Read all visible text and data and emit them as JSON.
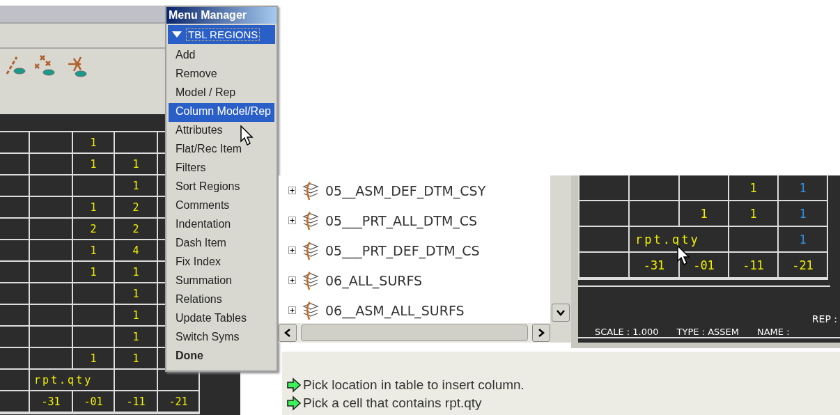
{
  "left_drawing": {
    "rows": [
      [
        null,
        null,
        "1",
        null,
        null
      ],
      [
        null,
        null,
        "1",
        "1",
        null
      ],
      [
        null,
        null,
        null,
        "1",
        null
      ],
      [
        null,
        null,
        "1",
        "2",
        null
      ],
      [
        null,
        null,
        "2",
        "2",
        null
      ],
      [
        null,
        null,
        "1",
        "4",
        null
      ],
      [
        null,
        null,
        "1",
        "1",
        null
      ],
      [
        null,
        null,
        null,
        "1",
        null
      ],
      [
        null,
        null,
        null,
        "1",
        null
      ],
      [
        null,
        null,
        null,
        "1",
        null
      ],
      [
        null,
        null,
        "1",
        "1",
        null
      ],
      [
        null,
        "rpt.qty",
        null,
        null,
        null
      ],
      [
        null,
        "-31",
        "-01",
        "-11",
        "-21"
      ]
    ]
  },
  "menu_manager": {
    "title": "Menu Manager",
    "header": {
      "label": "TBL REGIONS",
      "expanded": true
    },
    "items": [
      {
        "label": "Add",
        "selected": false
      },
      {
        "label": "Remove",
        "selected": false
      },
      {
        "label": "Model / Rep",
        "selected": false
      },
      {
        "label": "Column Model/Rep",
        "selected": true
      },
      {
        "label": "Attributes",
        "selected": false
      },
      {
        "label": "Flat/Rec Item",
        "selected": false
      },
      {
        "label": "Filters",
        "selected": false
      },
      {
        "label": "Sort Regions",
        "selected": false
      },
      {
        "label": "Comments",
        "selected": false
      },
      {
        "label": "Indentation",
        "selected": false
      },
      {
        "label": "Dash Item",
        "selected": false
      },
      {
        "label": "Fix Index",
        "selected": false
      },
      {
        "label": "Summation",
        "selected": false
      },
      {
        "label": "Relations",
        "selected": false
      },
      {
        "label": "Update Tables",
        "selected": false
      },
      {
        "label": "Switch Syms",
        "selected": false
      }
    ],
    "done": "Done"
  },
  "layer_tree": {
    "items": [
      {
        "label": "05__ASM_DEF_DTM_CSY",
        "expanded": false
      },
      {
        "label": "05___PRT_ALL_DTM_CS",
        "expanded": false
      },
      {
        "label": "05___PRT_DEF_DTM_CS",
        "expanded": false
      },
      {
        "label": "06_ALL_SURFS",
        "expanded": false
      },
      {
        "label": "06__ASM_ALL_SURFS",
        "expanded": false
      }
    ]
  },
  "right_drawing": {
    "rows": [
      [
        null,
        null,
        null,
        {
          "text": "1",
          "color": "#f0f000"
        },
        {
          "text": "1",
          "color": "#2f8fe0"
        }
      ],
      [
        null,
        null,
        {
          "text": "1",
          "color": "#f0f000"
        },
        {
          "text": "1",
          "color": "#f0f000"
        },
        {
          "text": "1",
          "color": "#2f8fe0"
        }
      ],
      [
        null,
        {
          "text": "rpt.qty",
          "color": "#f0f000"
        },
        null,
        null,
        {
          "text": "1",
          "color": "#2f8fe0"
        }
      ],
      [
        null,
        {
          "text": "-31",
          "color": "#f0f000"
        },
        {
          "text": "-01",
          "color": "#f0f000"
        },
        {
          "text": "-11",
          "color": "#f0f000"
        },
        {
          "text": "-21",
          "color": "#f0f000"
        }
      ]
    ],
    "title_block": {
      "scale": "SCALE : 1.000",
      "type": "TYPE : ASSEM",
      "name": "NAME :",
      "rep": "REP :"
    }
  },
  "messages": [
    "Pick location in table to insert column.",
    "Pick a cell that contains rpt.qty"
  ]
}
